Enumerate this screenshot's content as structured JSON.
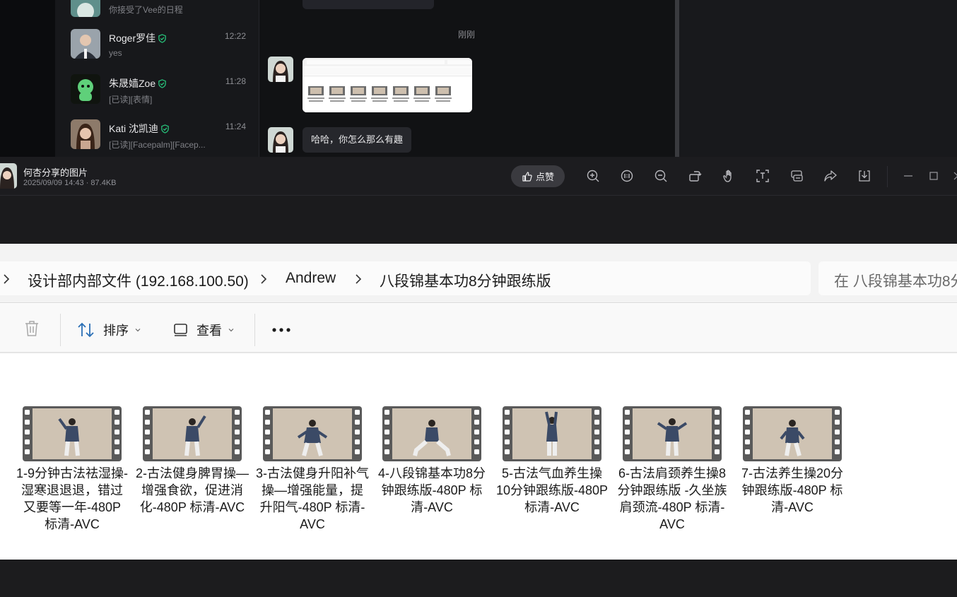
{
  "conversations": [
    {
      "name": "",
      "preview": "你接受了Vee的日程",
      "time": ""
    },
    {
      "name": "Roger罗佳",
      "preview": "yes",
      "time": "12:22"
    },
    {
      "name": "朱晟嫱Zoe",
      "preview": "[已读][表情]",
      "time": "11:28"
    },
    {
      "name": "Kati 沈凯迪",
      "preview": "[已读][Facepalm][Facep...",
      "time": "11:24"
    }
  ],
  "chat": {
    "time_divider": "刚刚",
    "text_message": "哈哈，你怎么那么有趣"
  },
  "viewer": {
    "title": "何杏分享的图片",
    "meta": "2025/09/09 14:43 · 87.4KB",
    "like_label": "点赞",
    "tools": [
      "zoom-in-icon",
      "actual-size-icon",
      "zoom-out-icon",
      "rotate-icon",
      "hand-icon",
      "ocr-icon",
      "translate-icon",
      "share-icon",
      "download-icon"
    ]
  },
  "explorer": {
    "breadcrumb": [
      "设计部内部文件 (192.168.100.50)",
      "Andrew",
      "八段锦基本功8分钟跟练版"
    ],
    "search_placeholder": "在 八段锦基本功8分",
    "commands": {
      "sort": "排序",
      "view": "查看"
    },
    "files": [
      "1-9分钟古法祛湿操-湿寒退退退，错过又要等一年-480P 标清-AVC",
      "2-古法健身脾胃操—增强食欲，促进消化-480P 标清-AVC",
      "3-古法健身升阳补气操—增强能量，提升阳气-480P 标清-AVC",
      "4-八段锦基本功8分钟跟练版-480P 标清-AVC",
      "5-古法气血养生操10分钟跟练版-480P 标清-AVC",
      "6-古法肩颈养生操8分钟跟练版 -久坐族肩颈流-480P 标清-AVC",
      "7-古法养生操20分钟跟练版-480P 标清-AVC"
    ]
  },
  "colors": {
    "verified": "#27c27a",
    "like_bg": "#3a3a3f",
    "thumb_bg": "#cfc3b3",
    "robe": "#3b4a66"
  }
}
